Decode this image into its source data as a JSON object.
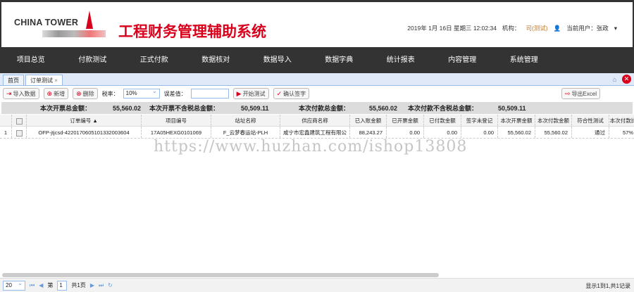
{
  "header": {
    "logo_text": "CHINA TOWER",
    "title": "工程财务管理辅助系统",
    "datetime": "2019年 1月 16日 星期三 12:02:34",
    "org_label": "机构：",
    "org_value": "司(测试)",
    "user_label": "当前用户：张政"
  },
  "nav": [
    "项目总览",
    "付款测试",
    "正式付款",
    "数据核对",
    "数据导入",
    "数据字典",
    "统计报表",
    "内容管理",
    "系统管理"
  ],
  "tabs": [
    {
      "label": "首页"
    },
    {
      "label": "订单测试",
      "close": "×"
    }
  ],
  "toolbar": {
    "import": "导入数据",
    "add": "新增",
    "delete": "删除",
    "tax_label": "税率：",
    "tax_value": "10%",
    "error_label": "误差值：",
    "error_value": "",
    "start": "开始测试",
    "confirm": "确认签字",
    "export": "导出Excel"
  },
  "summary": [
    {
      "label": "本次开票总金额：",
      "value": "55,560.02"
    },
    {
      "label": "本次开票不含税总金额：",
      "value": "50,509.11"
    },
    {
      "label": "本次付款总金额：",
      "value": "55,560.02"
    },
    {
      "label": "本次付款不含税总金额：",
      "value": "50,509.11"
    }
  ],
  "grid": {
    "headers": [
      "",
      "",
      "订单编号 ▲",
      "项目编号",
      "站址名称",
      "供应商名称",
      "已入账金额",
      "已开票金额",
      "已付款金额",
      "签字未登记",
      "本次开票金额",
      "本次付款金额",
      "符合性测试",
      "本次付款比"
    ],
    "rows": [
      [
        "1",
        "",
        "OFP-jtjcsd-4220170605101332003604",
        "17A05HEXG0101069",
        "F_云梦春运站-PLH",
        "咸宁市宏鑫建筑工程有限公",
        "88,243.27",
        "0.00",
        "0.00",
        "0.00",
        "55,560.02",
        "55,560.02",
        "通过",
        "57%"
      ]
    ]
  },
  "footer": {
    "page_size": "20",
    "page_prefix": "第",
    "page": "1",
    "page_suffix": "共1页",
    "info": "显示1到1,共1记录"
  },
  "watermark": "https://www.huzhan.com/ishop13808"
}
